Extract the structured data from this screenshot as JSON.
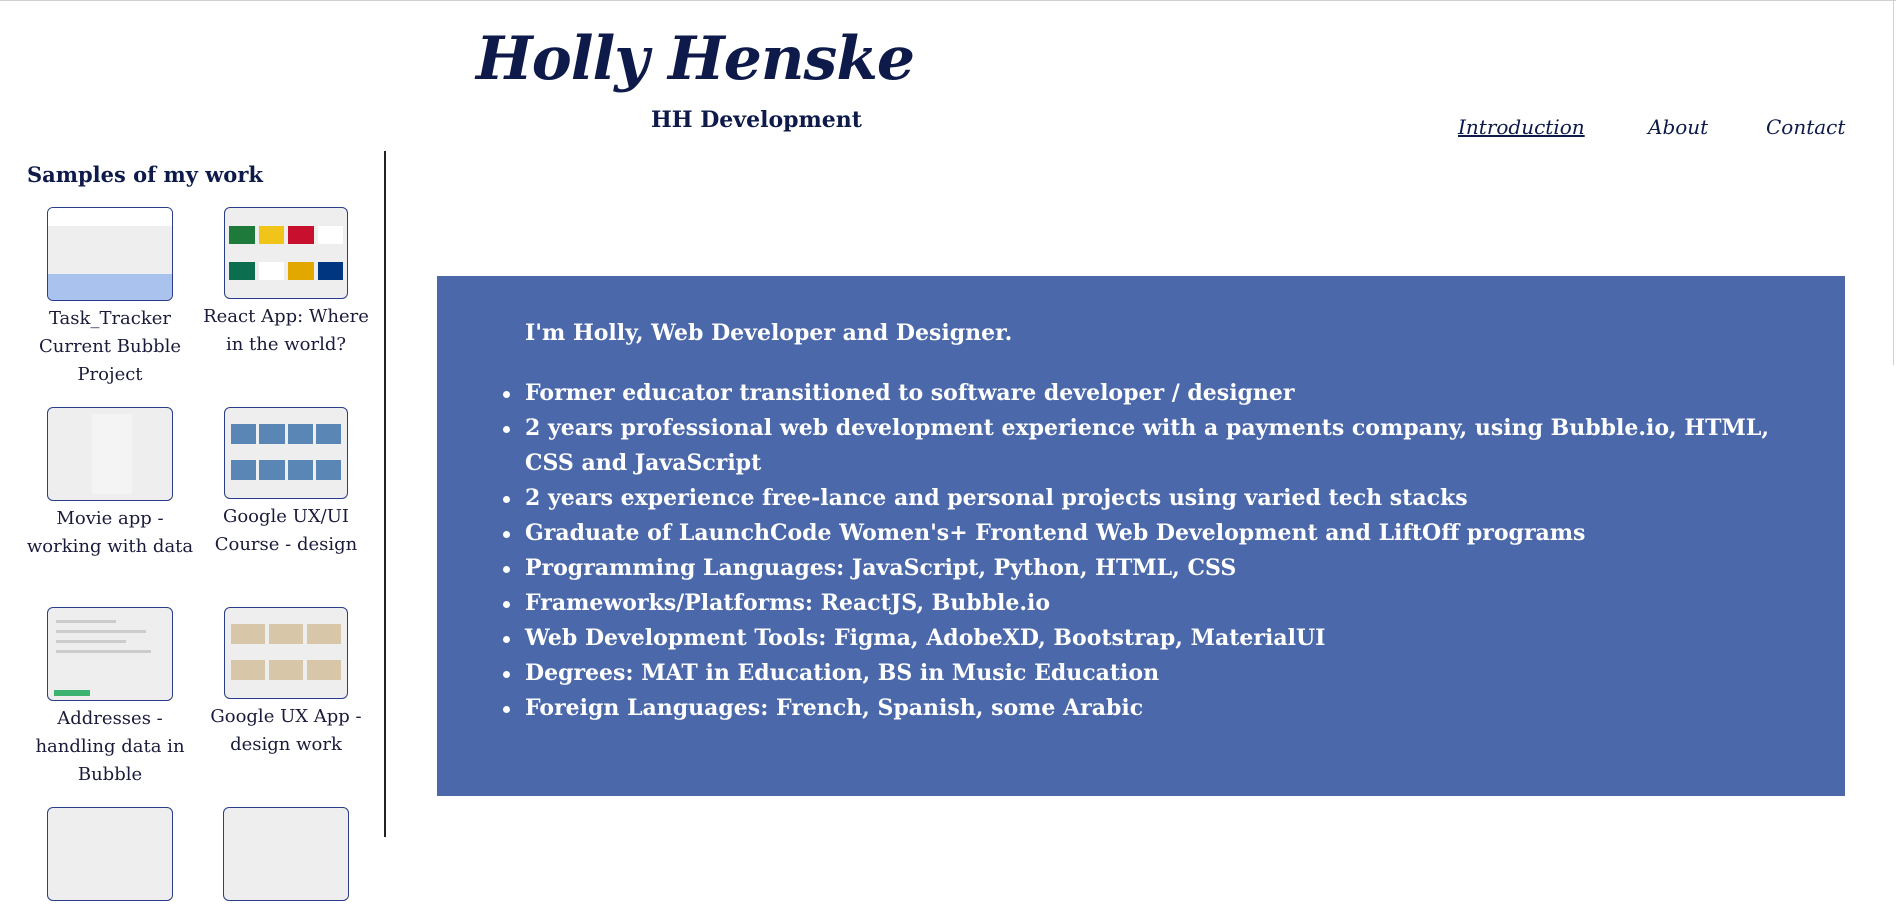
{
  "header": {
    "title": "Holly Henske",
    "subtitle": "HH Development"
  },
  "nav": [
    {
      "label": "Introduction",
      "active": true
    },
    {
      "label": "About",
      "active": false
    },
    {
      "label": "Contact",
      "active": false
    }
  ],
  "sidebar": {
    "heading": "Samples of my work",
    "samples": [
      {
        "caption": "Task_Tracker Current Bubble Project"
      },
      {
        "caption": "React App: Where in the world?"
      },
      {
        "caption": "Movie app - working with data"
      },
      {
        "caption": "Google UX/UI Course - design"
      },
      {
        "caption": "Addresses - handling data in Bubble"
      },
      {
        "caption": "Google UX App - design work"
      },
      {
        "caption": ""
      },
      {
        "caption": ""
      }
    ]
  },
  "intro": {
    "greeting": "I'm Holly, Web Developer and Designer.",
    "items": [
      "Former educator transitioned to software developer / designer",
      "2 years professional web development experience with a payments company, using Bubble.io, HTML, CSS and JavaScript",
      "2 years experience free-lance and personal projects using varied tech stacks",
      "Graduate of LaunchCode Women's+ Frontend Web Development and LiftOff programs",
      "Programming Languages: JavaScript, Python, HTML, CSS",
      "Frameworks/Platforms: ReactJS, Bubble.io",
      "Web Development Tools: Figma, AdobeXD, Bootstrap, MaterialUI",
      "Degrees: MAT in Education, BS in Music Education",
      "Foreign Languages: French, Spanish, some Arabic"
    ]
  },
  "colors": {
    "primary_text": "#0d1a4a",
    "panel_background": "#4b68aa",
    "panel_text": "#ffffff"
  }
}
